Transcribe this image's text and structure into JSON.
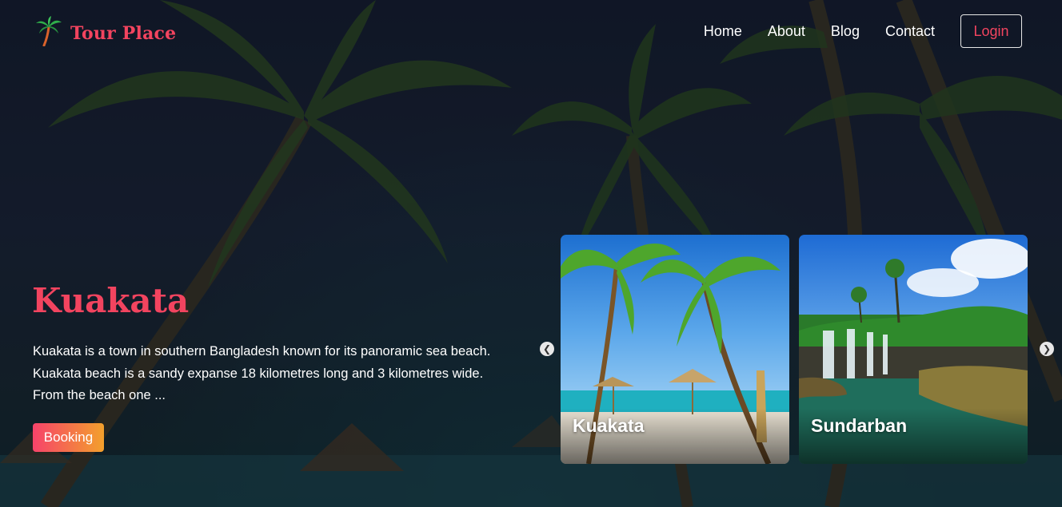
{
  "brand": {
    "name": "Tour Place",
    "icon": "palm-tree-icon"
  },
  "nav": {
    "links": [
      "Home",
      "About",
      "Blog",
      "Contact"
    ],
    "login": "Login"
  },
  "hero": {
    "title": "Kuakata",
    "description": "Kuakata is a town in southern Bangladesh known for its panoramic sea beach. Kuakata beach is a sandy expanse 18 kilometres long and 3 kilometres wide. From the beach one ...",
    "booking_label": "Booking"
  },
  "carousel": {
    "prev_icon": "chevron-left-icon",
    "next_icon": "chevron-right-icon",
    "cards": [
      {
        "label": "Kuakata"
      },
      {
        "label": "Sundarban"
      }
    ]
  },
  "colors": {
    "accent": "#f2445f",
    "booking_gradient_start": "#f6436a",
    "booking_gradient_end": "#f3a02c"
  }
}
